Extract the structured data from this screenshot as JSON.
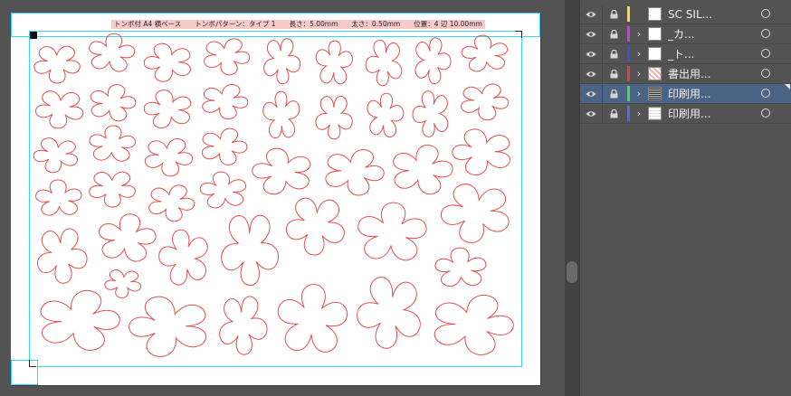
{
  "document": {
    "info_label": "トンボ付 A4 横ベース　　トンボパターン：タイプ 1　　長さ：5.00mm　　太さ：0.50mm　　位置：4 辺 10.00mm"
  },
  "colors": {
    "canvas_bg": "#535353",
    "guide": "#38d4f2",
    "shape_stroke": "#e05050",
    "panel_bg": "#535353",
    "selected_row": "#4b6485"
  },
  "layers": [
    {
      "name": "SC SIL...",
      "color": "#f2e03a",
      "thumbnail": "blank",
      "has_expander": false,
      "selected": false
    },
    {
      "name": "_カ...",
      "color": "#c73ee6",
      "thumbnail": "blank",
      "has_expander": true,
      "selected": false
    },
    {
      "name": "_ト...",
      "color": "#4a4adf",
      "thumbnail": "blank",
      "has_expander": true,
      "selected": false
    },
    {
      "name": "書出用...",
      "color": "#e04040",
      "thumbnail": "pink-pattern",
      "has_expander": true,
      "selected": false
    },
    {
      "name": "印刷用...",
      "color": "#4fd44f",
      "thumbnail": "dark-pattern",
      "has_expander": true,
      "selected": true
    },
    {
      "name": "印刷用...",
      "color": "#4a6fdf",
      "thumbnail": "lines-pattern",
      "has_expander": true,
      "selected": false
    }
  ],
  "icons": {
    "visibility": "eye-icon",
    "lock": "lock-icon",
    "expand": "chevron-right-icon",
    "target": "target-circle-icon"
  }
}
